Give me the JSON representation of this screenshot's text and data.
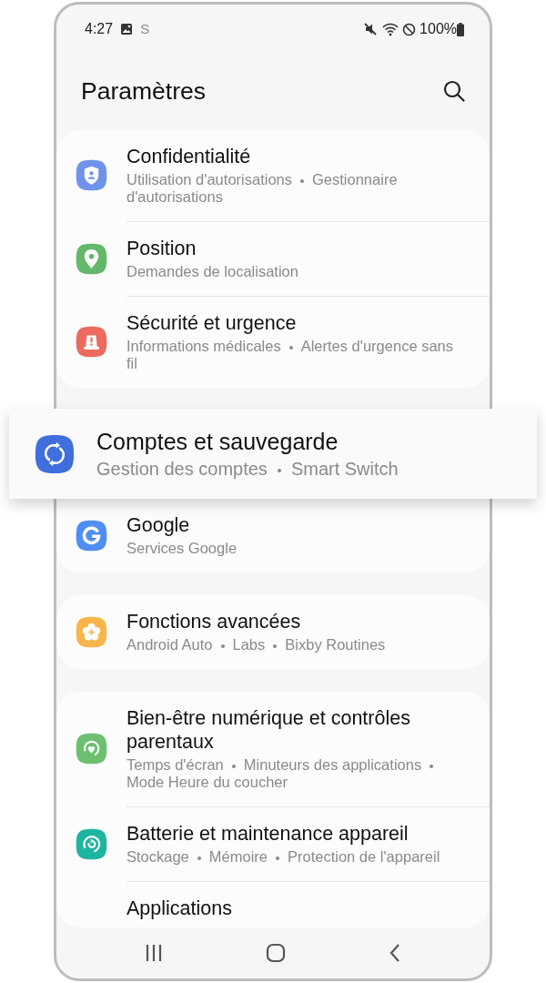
{
  "status_bar": {
    "time": "4:27",
    "app_glyph": "S",
    "battery": "100%"
  },
  "header": {
    "title": "Paramètres"
  },
  "groups": [
    {
      "items": [
        {
          "title": "Confidentialité",
          "subtitle": [
            "Utilisation d'autorisations",
            "Gestionnaire d'autorisations"
          ],
          "kind": "privacy",
          "color": "#6f93e8",
          "highlighted": false
        },
        {
          "title": "Position",
          "subtitle": [
            "Demandes de localisation"
          ],
          "kind": "location",
          "color": "#63b86a",
          "highlighted": false
        },
        {
          "title": "Sécurité et urgence",
          "subtitle": [
            "Informations médicales",
            "Alertes d'urgence sans fil"
          ],
          "kind": "emergency",
          "color": "#ec6a5e",
          "highlighted": false
        }
      ]
    },
    {
      "items": [
        {
          "title": "Comptes et sauvegarde",
          "subtitle": [
            "Gestion des comptes",
            "Smart Switch"
          ],
          "kind": "sync",
          "color": "#3f6fdd",
          "highlighted": true
        },
        {
          "title": "Google",
          "subtitle": [
            "Services Google"
          ],
          "kind": "google",
          "color": "#4f8ef2",
          "highlighted": false
        }
      ]
    },
    {
      "items": [
        {
          "title": "Fonctions avancées",
          "subtitle": [
            "Android Auto",
            "Labs",
            "Bixby Routines"
          ],
          "kind": "advanced",
          "color": "#f7b54a",
          "highlighted": false
        }
      ]
    },
    {
      "items": [
        {
          "title": "Bien-être numérique et contrôles parentaux",
          "subtitle": [
            "Temps d'écran",
            "Minuteurs des applications",
            "Mode Heure du coucher"
          ],
          "kind": "wellbeing",
          "color": "#6cc070",
          "highlighted": false
        },
        {
          "title": "Batterie et maintenance appareil",
          "subtitle": [
            "Stockage",
            "Mémoire",
            "Protection de l'appareil"
          ],
          "kind": "battery",
          "color": "#1eb5a0",
          "highlighted": false
        },
        {
          "title": "Applications",
          "highlighted": false
        }
      ]
    }
  ]
}
